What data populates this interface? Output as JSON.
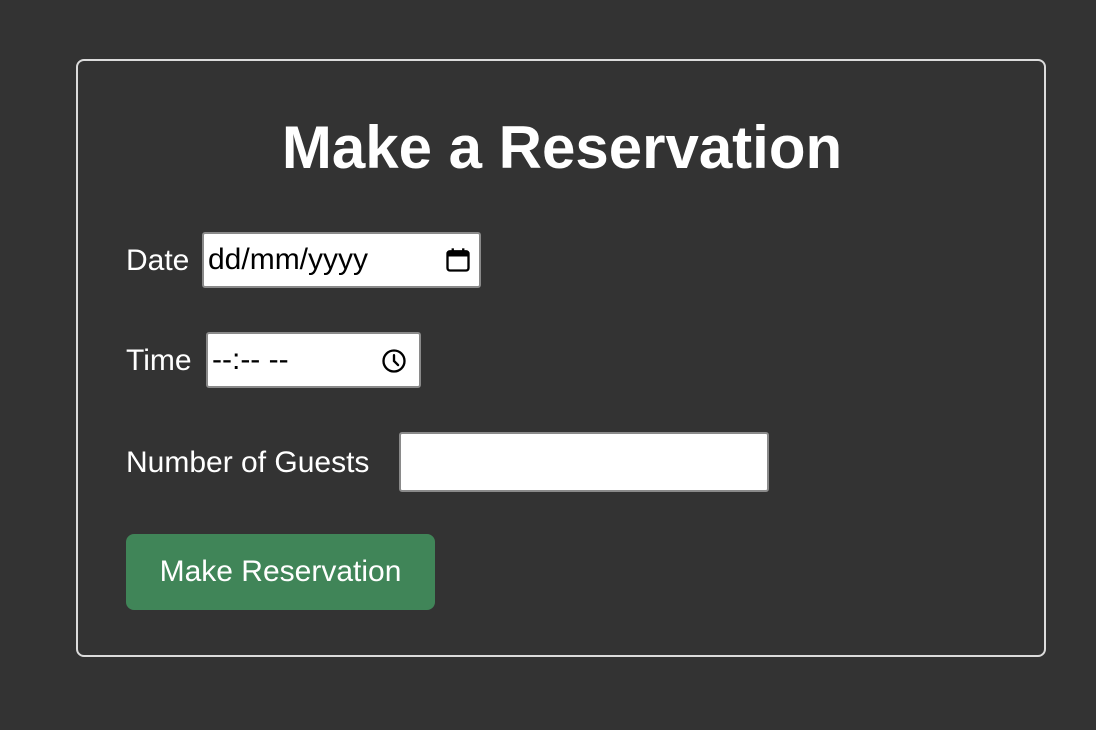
{
  "form": {
    "title": "Make a Reservation",
    "date": {
      "label": "Date",
      "placeholder": "dd/mm/yyyy",
      "icon": "calendar-icon"
    },
    "time": {
      "label": "Time",
      "placeholder": "--:-- --",
      "icon": "clock-icon"
    },
    "guests": {
      "label": "Number of Guests",
      "value": ""
    },
    "submit_label": "Make Reservation"
  },
  "colors": {
    "background": "#333333",
    "card_border": "#dcdcdc",
    "button": "#408558",
    "text": "#ffffff"
  }
}
